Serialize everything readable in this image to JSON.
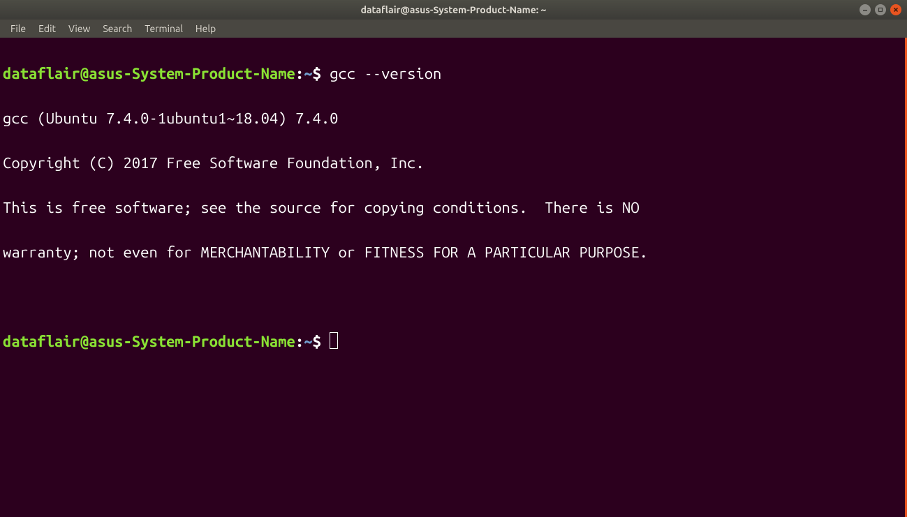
{
  "titlebar": {
    "title": "dataflair@asus-System-Product-Name: ~"
  },
  "menubar": {
    "items": [
      "File",
      "Edit",
      "View",
      "Search",
      "Terminal",
      "Help"
    ]
  },
  "prompt1": {
    "user_host": "dataflair@asus-System-Product-Name",
    "colon": ":",
    "path": "~",
    "dollar": "$ ",
    "command": "gcc --version"
  },
  "output": {
    "line1": "gcc (Ubuntu 7.4.0-1ubuntu1~18.04) 7.4.0",
    "line2": "Copyright (C) 2017 Free Software Foundation, Inc.",
    "line3": "This is free software; see the source for copying conditions.  There is NO",
    "line4": "warranty; not even for MERCHANTABILITY or FITNESS FOR A PARTICULAR PURPOSE."
  },
  "prompt2": {
    "user_host": "dataflair@asus-System-Product-Name",
    "colon": ":",
    "path": "~",
    "dollar": "$ "
  }
}
